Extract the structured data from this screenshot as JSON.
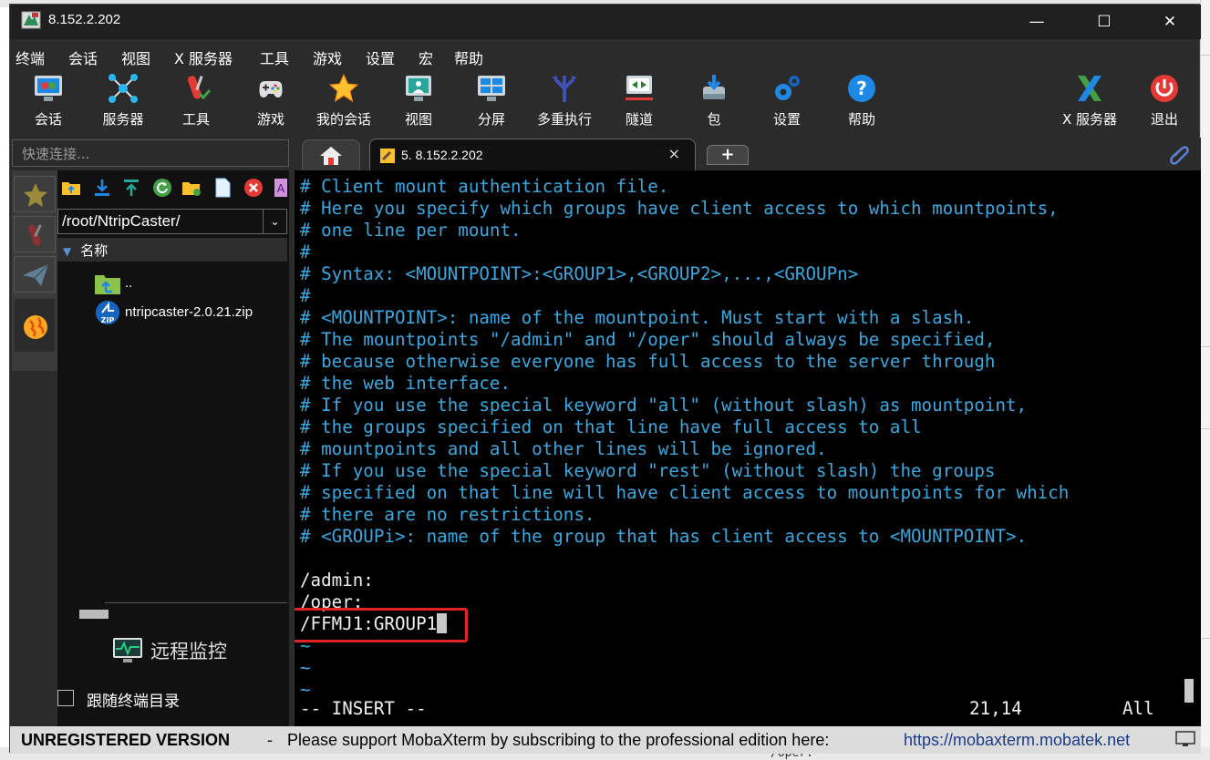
{
  "window": {
    "title": "8.152.2.202",
    "controls": {
      "minimize": "—",
      "maximize": "☐",
      "close": "✕"
    }
  },
  "menu": [
    "终端",
    "会话",
    "视图",
    "X 服务器",
    "工具",
    "游戏",
    "设置",
    "宏",
    "帮助"
  ],
  "toolbar": {
    "items": [
      "会话",
      "服务器",
      "工具",
      "游戏",
      "我的会话",
      "视图",
      "分屏",
      "多重执行",
      "隧道",
      "包",
      "设置",
      "帮助"
    ],
    "right": [
      "X 服务器",
      "退出"
    ]
  },
  "quick_connect": {
    "placeholder": "快速连接..."
  },
  "tabs": {
    "session_label": "5. 8.152.2.202",
    "close": "×",
    "add": "+"
  },
  "sftp": {
    "path": "/root/NtripCaster/",
    "dropdown": "⌄",
    "column_header": "名称",
    "files": [
      {
        "name": ".."
      },
      {
        "name": "ntripcaster-2.0.21.zip"
      }
    ],
    "remote_monitor": "远程监控",
    "follow_terminal": "跟随终端目录"
  },
  "terminal": {
    "comment_lines": [
      "# Client mount authentication file.",
      "# Here you specify which groups have client access to which mountpoints,",
      "# one line per mount.",
      "#",
      "# Syntax: <MOUNTPOINT>:<GROUP1>,<GROUP2>,...,<GROUPn>",
      "#",
      "# <MOUNTPOINT>: name of the mountpoint. Must start with a slash.",
      "# The mountpoints \"/admin\" and \"/oper\" should always be specified,",
      "# because otherwise everyone has full access to the server through",
      "# the web interface.",
      "# If you use the special keyword \"all\" (without slash) as mountpoint,",
      "# the groups specified on that line have full access to all",
      "# mountpoints and all other lines will be ignored.",
      "# If you use the special keyword \"rest\" (without slash) the groups",
      "# specified on that line will have client access to mountpoints for which",
      "# there are no restrictions.",
      "# <GROUPi>: name of the group that has client access to <MOUNTPOINT>."
    ],
    "config_lines": [
      "/admin:",
      "/oper:"
    ],
    "edited_line": "/FFMJ1:GROUP1",
    "tilde": "~",
    "mode": "-- INSERT --",
    "position": "21,14",
    "scroll": "All"
  },
  "footer": {
    "unregistered": "UNREGISTERED VERSION",
    "dash": "-",
    "message": "Please support MobaXterm by subscribing to the professional edition here:",
    "url": "https://mobaxterm.mobatek.net"
  },
  "background": {
    "partial_text": "/oper:"
  },
  "colors": {
    "comment": "#3aa8e0",
    "highlight_box": "#e32222",
    "terminal_bg": "#000000",
    "chrome_bg": "#2b2b2b"
  }
}
